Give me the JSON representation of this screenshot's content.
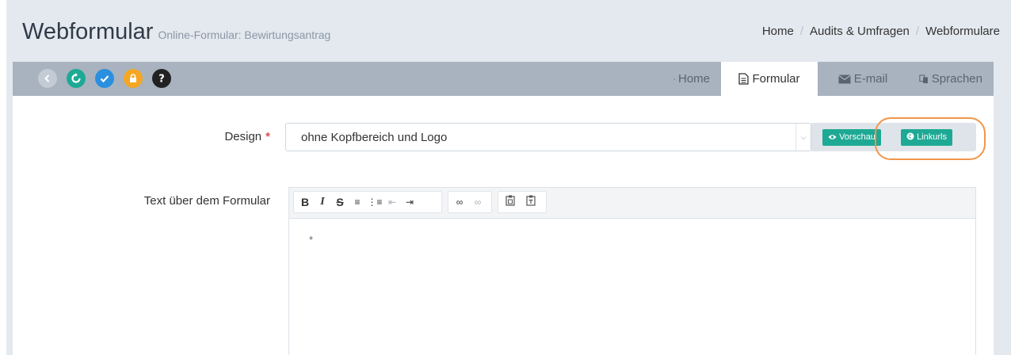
{
  "header": {
    "title": "Webformular",
    "subtitle": "Online-Formular: Bewirtungsantrag",
    "breadcrumb": [
      "Home",
      "Audits & Umfragen",
      "Webformulare"
    ]
  },
  "toolbar": {
    "icons": [
      {
        "name": "back-icon",
        "color": "#c3cbd4"
      },
      {
        "name": "refresh-icon",
        "color": "#1ea995"
      },
      {
        "name": "check-icon",
        "color": "#2b8fe0"
      },
      {
        "name": "lock-icon",
        "color": "#f5a623"
      },
      {
        "name": "help-icon",
        "color": "#222222"
      }
    ],
    "tabs": [
      {
        "label": "Home",
        "icon": "home-icon",
        "active": false
      },
      {
        "label": "Formular",
        "icon": "document-icon",
        "active": true
      },
      {
        "label": "E-mail",
        "icon": "envelope-icon",
        "active": false
      },
      {
        "label": "Sprachen",
        "icon": "languages-icon",
        "active": false
      }
    ]
  },
  "form": {
    "design": {
      "label": "Design",
      "required_mark": "*",
      "value": "ohne Kopfbereich und Logo",
      "preview_label": "Vorschau",
      "linkurls_label": "Linkurls"
    },
    "text_above": {
      "label": "Text über dem Formular",
      "content": "*"
    }
  },
  "colors": {
    "accent": "#1ea995",
    "callout": "#f0964a",
    "toolbar_bg": "#a8b3bf",
    "page_bg": "#e4e9ef"
  }
}
